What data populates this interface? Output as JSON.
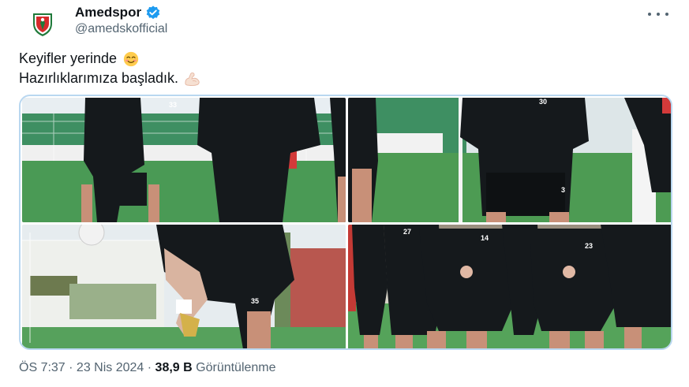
{
  "tweet": {
    "author": {
      "display_name": "Amedspor",
      "handle": "@amedskofficial",
      "verified": true,
      "avatar_icon": "amedspor-crest-icon"
    },
    "text_lines": [
      {
        "text": "Keyifler yerinde",
        "emoji": "smiling-face-icon"
      },
      {
        "text": "Hazırlıklarımıza başladık.",
        "emoji": "flexed-biceps-icon"
      }
    ],
    "media": {
      "photos": [
        {
          "jersey_numbers": [
            "33"
          ]
        },
        {
          "jersey_numbers": [
            "30",
            "3"
          ]
        },
        {
          "jersey_numbers": [
            "35"
          ]
        },
        {
          "jersey_numbers": [
            "27",
            "14",
            "23"
          ]
        }
      ]
    },
    "timestamp": "ÖS 7:37 · 23 Nis 2024 ·",
    "views_count": "38,9 B",
    "views_label": "Görüntülenme"
  },
  "colors": {
    "accent": "#1d9bf0",
    "text_primary": "#0f1419",
    "text_secondary": "#536471",
    "media_border": "#b9d7f0",
    "kit": "#15191c",
    "pitch": "#3f8f4c"
  }
}
